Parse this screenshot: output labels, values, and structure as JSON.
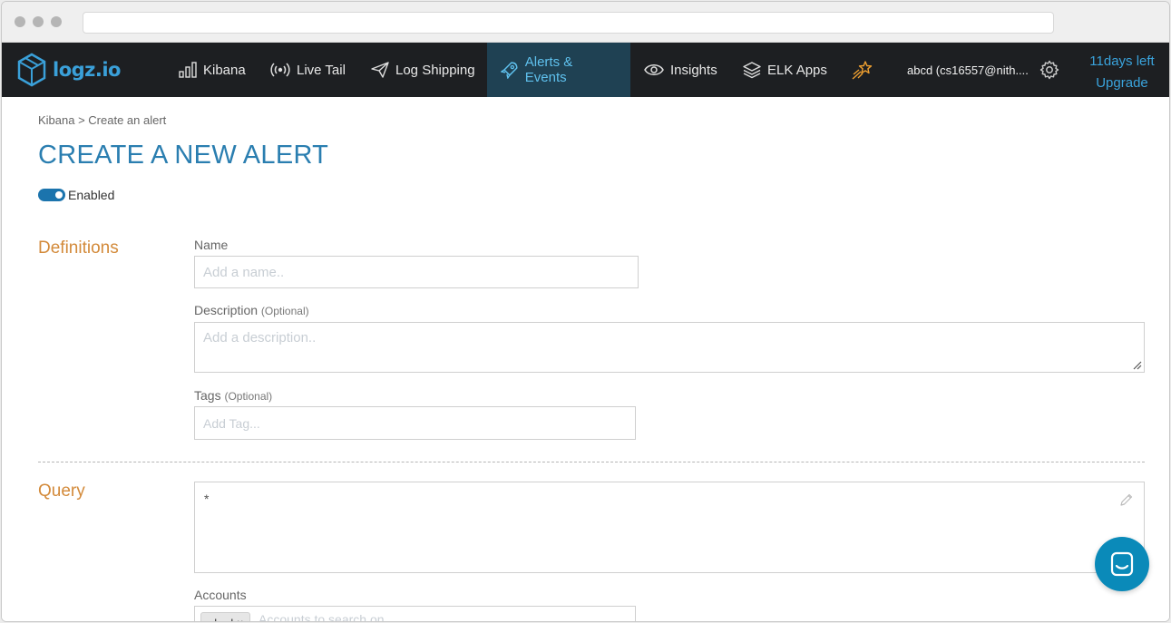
{
  "nav": {
    "logo_text": "logz.io",
    "items": [
      {
        "label": "Kibana",
        "icon": "bar-chart-icon"
      },
      {
        "label": "Live Tail",
        "icon": "broadcast-icon"
      },
      {
        "label": "Log Shipping",
        "icon": "paper-plane-icon"
      },
      {
        "label": "Alerts & Events",
        "icon": "rocket-icon",
        "active": true
      },
      {
        "label": "Insights",
        "icon": "eye-icon"
      },
      {
        "label": "ELK Apps",
        "icon": "layers-icon"
      }
    ],
    "user": "abcd (cs16557@nith....",
    "trial_days": "11days left",
    "upgrade": "Upgrade"
  },
  "breadcrumb": "Kibana > Create an alert",
  "title": "CREATE A NEW ALERT",
  "enabled_label": "Enabled",
  "definitions": {
    "section_title": "Definitions",
    "name_label": "Name",
    "name_placeholder": "Add a name..",
    "description_label": "Description",
    "description_optional": "(Optional)",
    "description_placeholder": "Add a description..",
    "tags_label": "Tags",
    "tags_optional": "(Optional)",
    "tags_placeholder": "Add Tag..."
  },
  "query": {
    "section_title": "Query",
    "value": "*",
    "accounts_label": "Accounts",
    "account_chip": "abcd",
    "chip_remove": "×",
    "accounts_placeholder": "Accounts to search on"
  },
  "colors": {
    "accent_blue": "#2a7eb0",
    "section_orange": "#d38a3a",
    "nav_bg": "#1d1f22",
    "nav_active_bg": "#1f4153",
    "chat_button": "#0a8ab9"
  }
}
